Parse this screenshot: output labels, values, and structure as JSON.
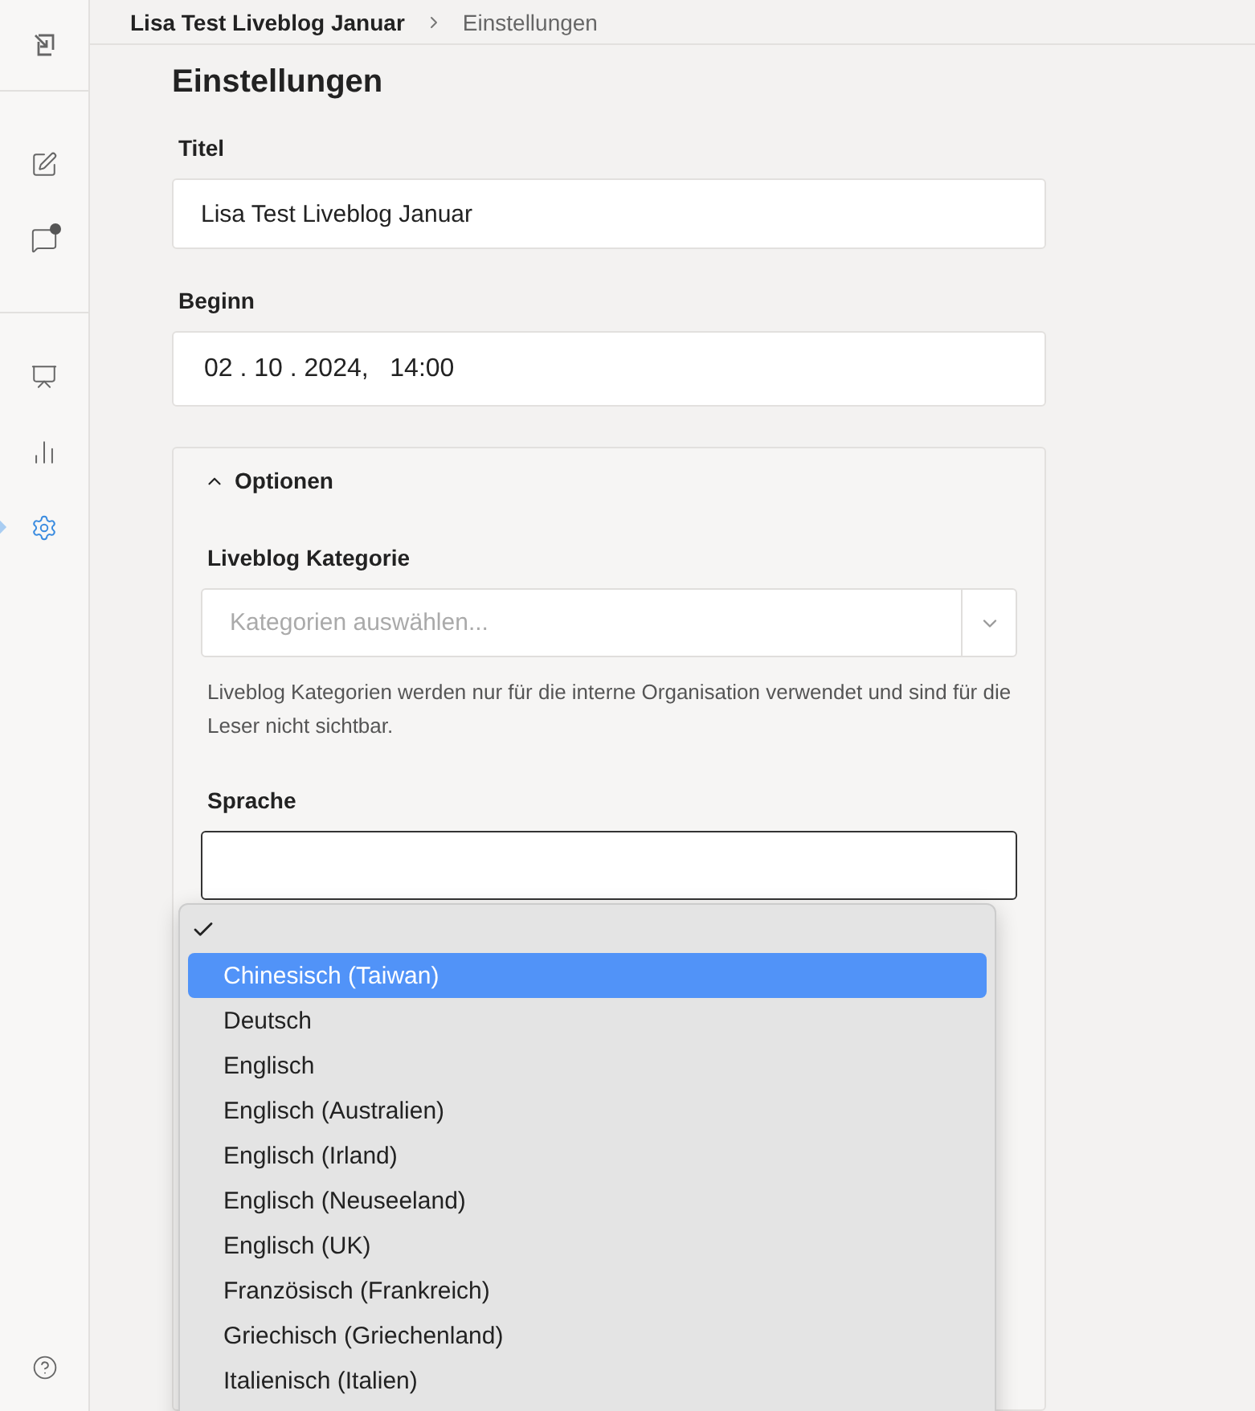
{
  "sidebar": {
    "items": [
      {
        "selected": false,
        "badge": false
      },
      {
        "selected": false,
        "badge": false
      },
      {
        "selected": false,
        "badge": true
      },
      {
        "selected": false,
        "badge": false
      },
      {
        "selected": false,
        "badge": false
      },
      {
        "selected": true,
        "badge": false
      }
    ]
  },
  "breadcrumb": [
    "Lisa Test Liveblog Januar",
    "Einstellungen"
  ],
  "page_title": "Einstellungen",
  "fields": [
    {
      "label": "Titel",
      "value": "Lisa Test Liveblog Januar"
    },
    {
      "label": "Beginn",
      "value": "02 . 10 . 2024,   14:00"
    }
  ],
  "options_panel": {
    "title": "Optionen",
    "expanded": true,
    "category": {
      "label": "Liveblog Kategorie",
      "placeholder": "Kategorien auswählen...",
      "hint": "Liveblog Kategorien werden nur für die interne Organisation verwendet und sind für die Leser nicht sichtbar."
    },
    "language": {
      "label": "Sprache"
    }
  },
  "language_menu": [
    {
      "checked": true,
      "highlighted": false
    },
    {
      "label": "Chinesisch (Taiwan)",
      "checked": false,
      "highlighted": true
    },
    {
      "label": "Deutsch",
      "checked": false,
      "highlighted": false
    },
    {
      "label": "Englisch",
      "checked": false,
      "highlighted": false
    },
    {
      "label": "Englisch (Australien)",
      "checked": false,
      "highlighted": false
    },
    {
      "label": "Englisch (Irland)",
      "checked": false,
      "highlighted": false
    },
    {
      "label": "Englisch (Neuseeland)",
      "checked": false,
      "highlighted": false
    },
    {
      "label": "Englisch (UK)",
      "checked": false,
      "highlighted": false
    },
    {
      "label": "Französisch (Frankreich)",
      "checked": false,
      "highlighted": false
    },
    {
      "label": "Griechisch (Griechenland)",
      "checked": false,
      "highlighted": false
    },
    {
      "label": "Italienisch (Italien)",
      "checked": false,
      "highlighted": false
    }
  ]
}
